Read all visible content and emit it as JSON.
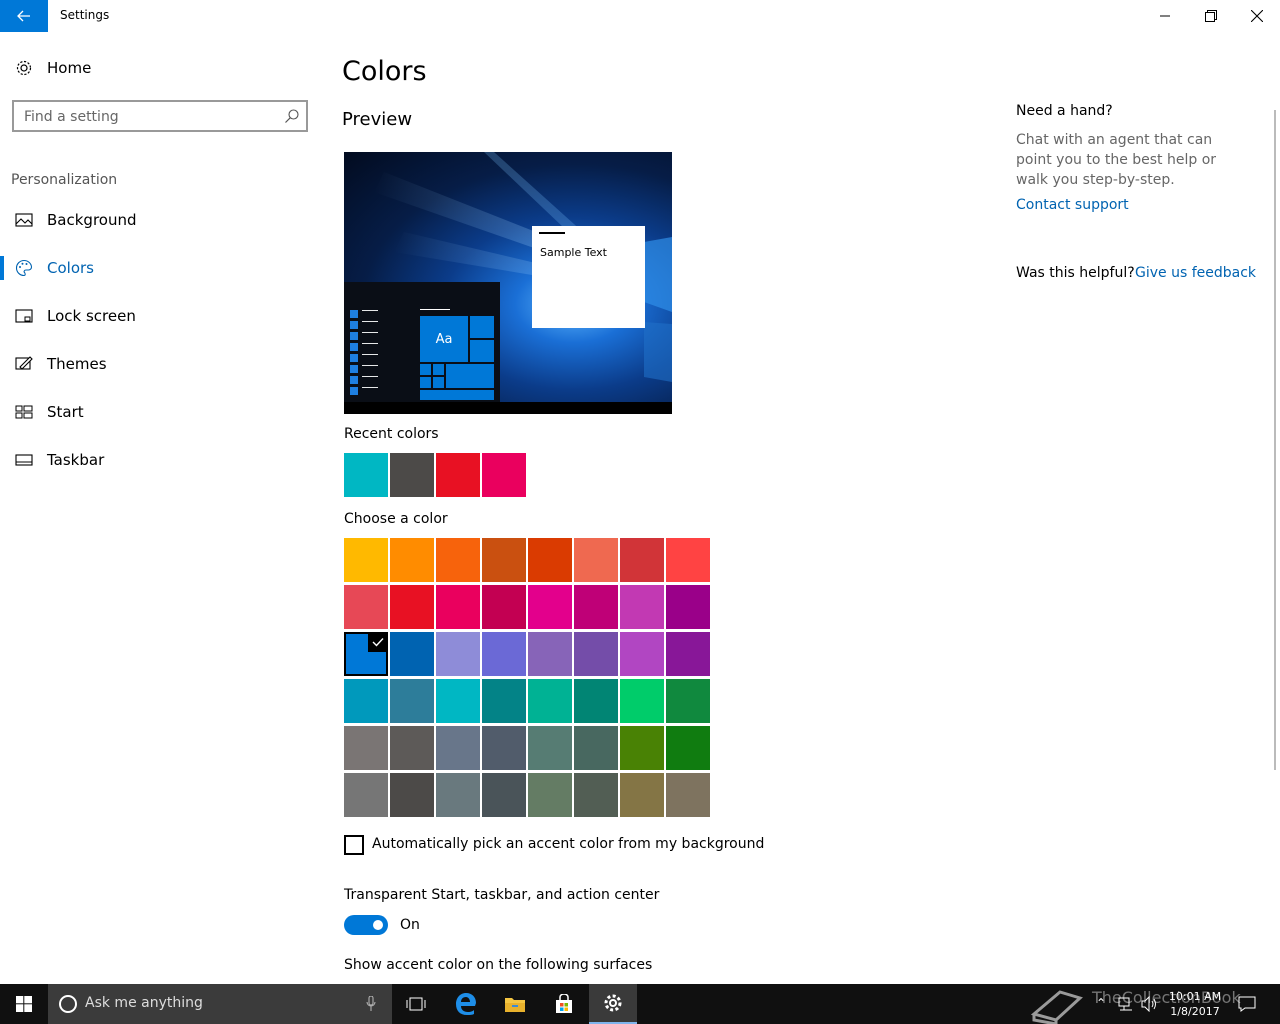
{
  "window": {
    "title": "Settings"
  },
  "sidebar": {
    "home_label": "Home",
    "search_placeholder": "Find a setting",
    "section_heading": "Personalization",
    "items": [
      {
        "label": "Background",
        "icon": "image-icon",
        "active": false
      },
      {
        "label": "Colors",
        "icon": "palette-icon",
        "active": true
      },
      {
        "label": "Lock screen",
        "icon": "lock-screen-icon",
        "active": false
      },
      {
        "label": "Themes",
        "icon": "brush-icon",
        "active": false
      },
      {
        "label": "Start",
        "icon": "start-icon",
        "active": false
      },
      {
        "label": "Taskbar",
        "icon": "taskbar-icon",
        "active": false
      }
    ]
  },
  "main": {
    "title": "Colors",
    "preview_heading": "Preview",
    "preview_tile_label": "Aa",
    "preview_sample_text": "Sample Text",
    "recent_heading": "Recent colors",
    "recent_colors": [
      "#00b7c3",
      "#4c4a48",
      "#e81123",
      "#ea005e"
    ],
    "choose_heading": "Choose a color",
    "selected_color": "#0078d7",
    "color_grid": [
      [
        "#ffb900",
        "#ff8c00",
        "#f7630c",
        "#ca5010",
        "#da3b01",
        "#ef6950",
        "#d13438",
        "#ff4343"
      ],
      [
        "#e74856",
        "#e81123",
        "#ea005e",
        "#c30052",
        "#e3008c",
        "#bf0077",
        "#c239b3",
        "#9a0089"
      ],
      [
        "#0078d7",
        "#0063b1",
        "#8e8cd8",
        "#6b69d6",
        "#8764b8",
        "#744da9",
        "#b146c2",
        "#881798"
      ],
      [
        "#0099bc",
        "#2d7d9a",
        "#00b7c3",
        "#038387",
        "#00b294",
        "#018574",
        "#00cc6a",
        "#10893e"
      ],
      [
        "#7a7574",
        "#5d5a58",
        "#68768a",
        "#515c6b",
        "#567c73",
        "#486860",
        "#498205",
        "#107c10"
      ],
      [
        "#767676",
        "#4c4a48",
        "#69797e",
        "#4a5459",
        "#647c64",
        "#525e54",
        "#847545",
        "#7e735f"
      ]
    ],
    "auto_pick_label": "Automatically pick an accent color from my background",
    "auto_pick_checked": false,
    "transparent_heading": "Transparent Start, taskbar, and action center",
    "transparent_state": "On",
    "surfaces_heading": "Show accent color on the following surfaces"
  },
  "help": {
    "heading": "Need a hand?",
    "text": "Chat with an agent that can point you to the best help or walk you step-by-step.",
    "contact_link": "Contact support",
    "helpful_label": "Was this helpful?",
    "feedback_link": "Give us feedback"
  },
  "taskbar": {
    "search_text": "Ask me anything",
    "time": "10:01 AM",
    "date": "1/8/2017",
    "watermark": "TheCollectionBook"
  }
}
